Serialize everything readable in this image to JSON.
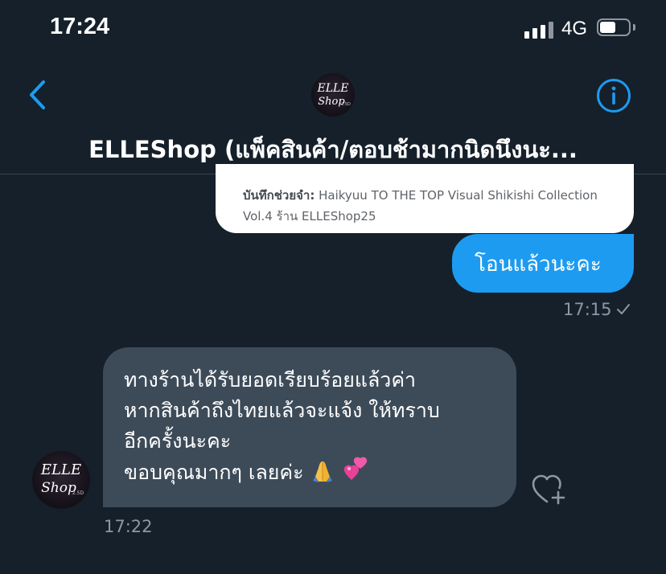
{
  "status_bar": {
    "time": "17:24",
    "network": "4G",
    "battery_level": 0.55,
    "signal_bars_active": 3,
    "signal_bars_total": 4
  },
  "header": {
    "title": "ELLEShop (แพ็คสินค้า/ตอบช้ามากนิดนึงนะ...",
    "avatar_text_line1": "ELLE",
    "avatar_text_line2": "Shop",
    "avatar_text_small": "2.5D"
  },
  "messages": {
    "note": {
      "label": "บันทึกช่วยจำ:",
      "line1_text": " Haikyuu TO THE TOP Visual Shikishi Collection",
      "line2_text": "Vol.4 ร้าน ELLEShop25"
    },
    "outgoing": {
      "text": "โอนแล้วนะคะ",
      "time": "17:15"
    },
    "incoming": {
      "lines": [
        "ทางร้านได้รับยอดเรียบร้อยแล้วค่า",
        "หากสินค้าถึงไทยแล้วจะแจ้ง ให้ทราบ",
        "อีกครั้งนะคะ",
        "ขอบคุณมากๆ เลยค่ะ"
      ],
      "time": "17:22"
    }
  },
  "icons": {
    "back": "chevron-left-icon",
    "info": "info-circle-icon",
    "read_check": "check-icon",
    "react": "heart-plus-icon",
    "emoji1": "folded-hands-emoji",
    "emoji2": "two-hearts-emoji"
  },
  "colors": {
    "background": "#15202b",
    "accent": "#1d9bf0",
    "incoming_bubble": "#3d4b59",
    "muted_text": "#8b98a5"
  }
}
